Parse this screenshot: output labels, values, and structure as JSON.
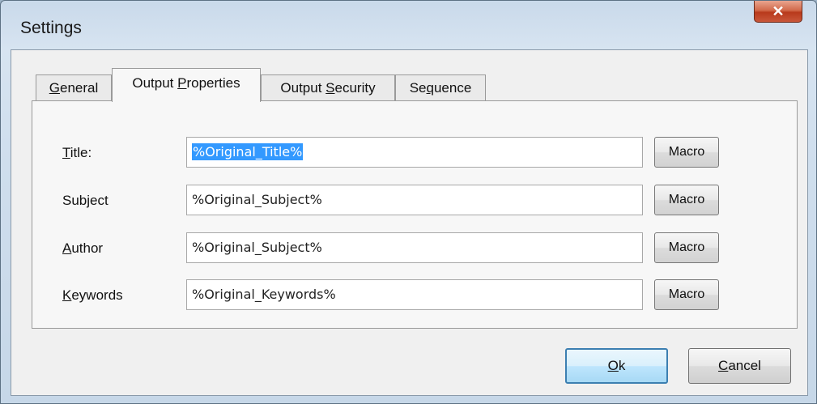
{
  "window": {
    "title": "Settings",
    "close_glyph": "✕"
  },
  "tabs": [
    {
      "pre": "",
      "key": "G",
      "post": "eneral",
      "active": false
    },
    {
      "pre": "Output ",
      "key": "P",
      "post": "roperties",
      "active": true
    },
    {
      "pre": "Output ",
      "key": "S",
      "post": "ecurity",
      "active": false
    },
    {
      "pre": "Se",
      "key": "q",
      "post": "uence",
      "active": false
    }
  ],
  "fields": [
    {
      "label_pre": "",
      "label_key": "T",
      "label_post": "itle:",
      "value": "%Original_Title%",
      "selected": true
    },
    {
      "label_pre": "Subject",
      "label_key": "",
      "label_post": "",
      "value": "%Original_Subject%",
      "selected": false
    },
    {
      "label_pre": "",
      "label_key": "A",
      "label_post": "uthor",
      "value": "%Original_Subject%",
      "selected": false
    },
    {
      "label_pre": "",
      "label_key": "K",
      "label_post": "eywords",
      "value": "%Original_Keywords%",
      "selected": false
    }
  ],
  "macro_label": "Macro",
  "buttons": {
    "ok": {
      "key": "O",
      "post": "k"
    },
    "cancel": {
      "key": "C",
      "post": "ancel"
    }
  },
  "colors": {
    "selection": "#3399ff",
    "close_button": "#c9573a",
    "default_button_border": "#3c7fb1"
  }
}
